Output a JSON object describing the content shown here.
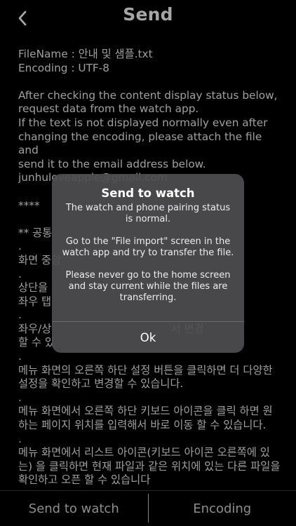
{
  "header": {
    "back_icon": "chevron-left-icon",
    "title": "Send"
  },
  "content": {
    "file_name": "FileName : 안내 및 샘플.txt",
    "encoding": "Encoding : UTF-8",
    "instructions": [
      "After checking the content display status below,",
      "request data from the watch app.",
      "If the text is not displayed normally even after",
      "changing the encoding, please attach the file and",
      "send it to the email address below.",
      "junhuloveapple@gmail.com"
    ],
    "stars": "****",
    "section_marker": "** 공통",
    "dot_1": ".",
    "screen_line": "화면 중앙",
    "dot_2": ".",
    "top_line_1": "상단을",
    "top_line_2": "좌우 탭",
    "dot_3": ".",
    "lr_line_1": "좌우/상                                   서 변경",
    "lr_line_2": "할 수 있",
    "dot_4": ".",
    "menu1_line_1": "메뉴 화면의 오른쪽 하단 설정 버튼을 클릭하면 더 다양한",
    "menu1_line_2": "설정을 확인하고 변경할 수 있습니다.",
    "dot_5": ".",
    "menu2_line_1": "메뉴 화면에서 오른쪽 하단 키보드 아이콘을 클릭 하면 원",
    "menu2_line_2": "하는 페이지 위치를 입력해서 바로 이동 할 수 있습니다.",
    "dot_6": ".",
    "menu3_line_1": "메뉴 화면에서 리스트 아이콘(키보드 아이콘 오른쪽에 있",
    "menu3_line_2": "는) 을 클릭하면 현재 파일과 같은 위치에 있는 다른 파일을",
    "menu3_line_3": "확인하고 오픈 할 수 있습니다"
  },
  "bottom_bar": {
    "send_label": "Send to watch",
    "encoding_label": "Encoding"
  },
  "alert": {
    "title": "Send to watch",
    "message_1": "The watch and phone pairing status is normal.",
    "message_2": "Go to the \"File import\" screen in the watch app and try to transfer the file.",
    "message_3": "Please never go to the home screen and stay current while the files are transferring.",
    "ok_label": "Ok"
  }
}
